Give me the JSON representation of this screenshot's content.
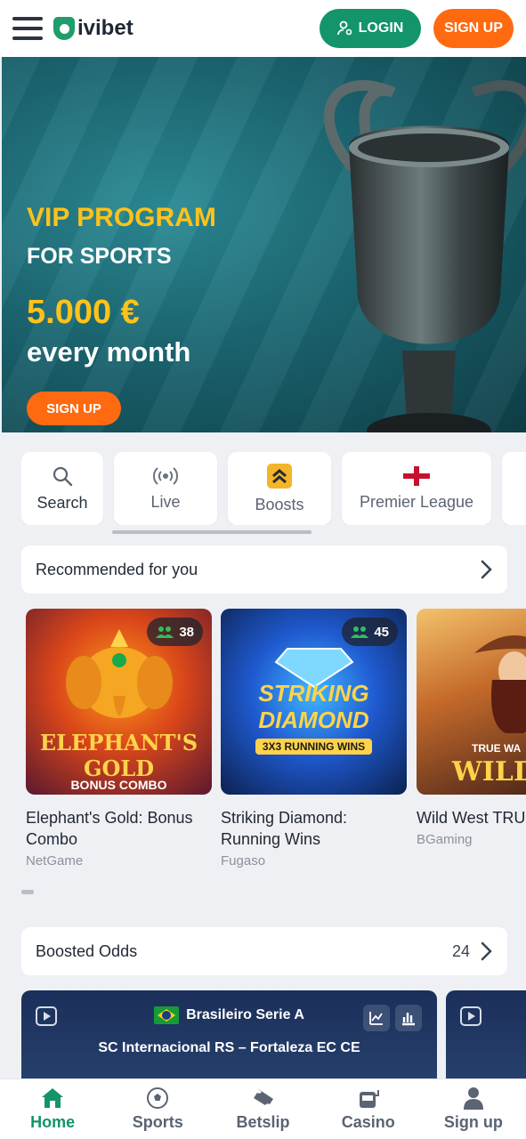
{
  "header": {
    "brand": "ivibet",
    "login_label": "LOGIN",
    "signup_label": "SIGN UP"
  },
  "hero": {
    "title": "VIP PROGRAM",
    "subtitle": "FOR SPORTS",
    "amount": "5.000 €",
    "period": "every month",
    "button_label": "SIGN UP",
    "slides_total": 6,
    "active_slide": 5,
    "colors": {
      "accent": "#ffc21a",
      "button": "#ff6a10"
    }
  },
  "quick_nav": [
    {
      "label": "Search",
      "icon": "search-icon"
    },
    {
      "label": "Live",
      "icon": "live-broadcast-icon"
    },
    {
      "label": "Boosts",
      "icon": "boost-chevrons-icon"
    },
    {
      "label": "Premier League",
      "icon": "england-flag-icon"
    }
  ],
  "recommended": {
    "title": "Recommended for you",
    "games": [
      {
        "name": "Elephant's Gold: Bonus Combo",
        "provider": "NetGame",
        "players": "38",
        "art_title": "ELEPHANT'S GOLD",
        "art_subtitle": "BONUS COMBO"
      },
      {
        "name": "Striking Diamond: Running Wins",
        "provider": "Fugaso",
        "players": "45",
        "art_title": "STRIKING DIAMOND",
        "art_subtitle": "3X3 RUNNING WINS"
      },
      {
        "name": "Wild West TRU",
        "provider": "BGaming",
        "art_title": "WILD W",
        "art_subtitle": "TRUE WA"
      }
    ]
  },
  "boosted": {
    "title": "Boosted Odds",
    "count": "24",
    "match": {
      "league": "Brasileiro Serie A",
      "teams": "SC Internacional RS – Fortaleza EC CE"
    }
  },
  "bottom_nav": [
    {
      "label": "Home",
      "icon": "home-icon",
      "active": true
    },
    {
      "label": "Sports",
      "icon": "soccer-ball-icon",
      "active": false
    },
    {
      "label": "Betslip",
      "icon": "ticket-icon",
      "active": false
    },
    {
      "label": "Casino",
      "icon": "slot-machine-icon",
      "active": false
    },
    {
      "label": "Sign up",
      "icon": "user-icon",
      "active": false
    }
  ]
}
